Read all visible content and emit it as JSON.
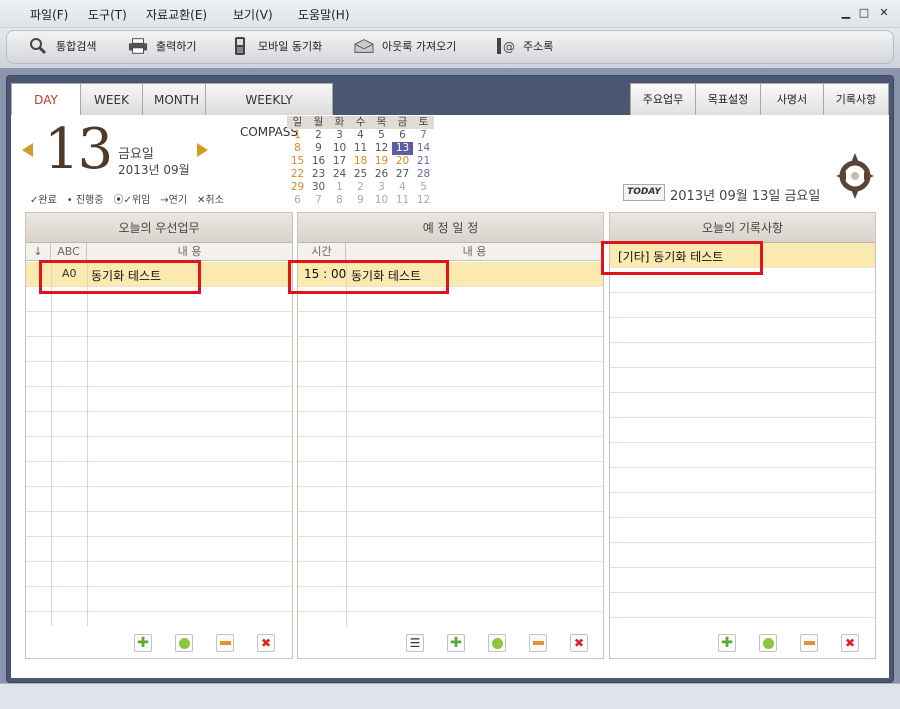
{
  "menu": {
    "items": [
      "파일(F)",
      "도구(T)",
      "자료교환(E)",
      "보기(V)",
      "도움말(H)"
    ]
  },
  "toolbar": {
    "items": [
      "통합검색",
      "출력하기",
      "모바일 동기화",
      "아웃룩 가져오기",
      "주소록"
    ]
  },
  "tabs": {
    "left": [
      "DAY",
      "WEEK",
      "MONTH",
      "WEEKLY COMPASS"
    ],
    "right": [
      "주요업무",
      "목표설정",
      "사명서",
      "기록사항"
    ],
    "active": "DAY"
  },
  "date": {
    "day": "13",
    "weekday": "금요일",
    "year_month": "2013년 09월"
  },
  "legend": [
    "✓완료",
    "• 진행중",
    "⦿✓위임",
    "→연기",
    "✕취소"
  ],
  "calendar": {
    "headers": [
      "일",
      "월",
      "화",
      "수",
      "목",
      "금",
      "토"
    ],
    "weeks": [
      [
        "1",
        "2",
        "3",
        "4",
        "5",
        "6",
        "7"
      ],
      [
        "8",
        "9",
        "10",
        "11",
        "12",
        "13",
        "14"
      ],
      [
        "15",
        "16",
        "17",
        "18",
        "19",
        "20",
        "21"
      ],
      [
        "22",
        "23",
        "24",
        "25",
        "26",
        "27",
        "28"
      ],
      [
        "29",
        "30",
        "1",
        "2",
        "3",
        "4",
        "5"
      ],
      [
        "6",
        "7",
        "8",
        "9",
        "10",
        "11",
        "12"
      ]
    ],
    "selected": "13"
  },
  "today": {
    "badge": "TODAY",
    "text": "2013년 09월 13일 금요일"
  },
  "priority": {
    "title": "오늘의 우선업무",
    "col_arrow": "↓",
    "col_abc": "ABC",
    "col_content": "내 용",
    "rows": [
      {
        "abc": "A0",
        "content": "동기화 테스트"
      }
    ]
  },
  "schedule": {
    "title": "예 정 일 정",
    "col_time": "시간",
    "col_content": "내 용",
    "rows": [
      {
        "time": "15 : 00",
        "content": "동기화 테스트"
      }
    ]
  },
  "notes": {
    "title": "오늘의 기록사항",
    "rows": [
      {
        "content": "[기타] 동기화 테스트"
      }
    ]
  },
  "colors": {
    "accent": "#c0392b",
    "highlight": "#faeab0",
    "frame": "#4b5772",
    "arrow": "#d49a28"
  }
}
